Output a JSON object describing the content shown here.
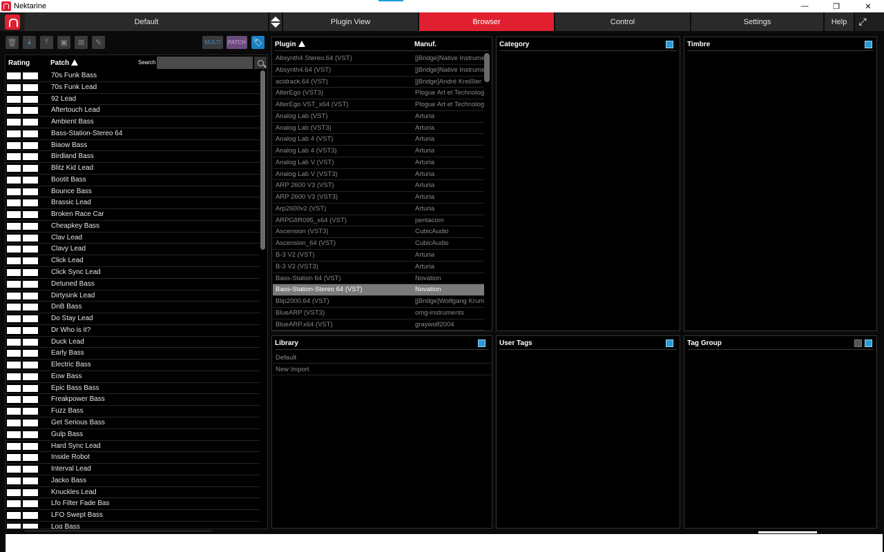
{
  "window": {
    "title": "Nektarine",
    "controls": [
      "—",
      "❐",
      "✕"
    ]
  },
  "nav": {
    "preset": "Default",
    "tabs": [
      {
        "label": "Plugin View",
        "active": false
      },
      {
        "label": "Browser",
        "active": true
      },
      {
        "label": "Control",
        "active": false
      },
      {
        "label": "Settings",
        "active": false
      },
      {
        "label": "Help",
        "active": false
      }
    ]
  },
  "toolbar": {
    "multi_label": "MULTI",
    "patch_label": "PATCH",
    "icons": [
      "trash-icon",
      "download-icon",
      "upload-icon",
      "save-icon",
      "add-icon",
      "edit-icon",
      "tag-icon"
    ]
  },
  "patches": {
    "col_rating": "Rating",
    "col_patch": "Patch",
    "search_label": "Search",
    "search_value": "",
    "items": [
      "70s Funk Bass",
      "70s Funk Lead",
      "92 Lead",
      "Aftertouch Lead",
      "Ambient Bass",
      "Bass-Station-Stereo 64",
      "Biaow Bass",
      "Birdland Bass",
      "Blitz Kid Lead",
      "Bootit Bass",
      "Bounce Bass",
      "Brassic Lead",
      "Broken Race Car",
      "Cheapkey Bass",
      "Clav Lead",
      "Clavy Lead",
      "Click Lead",
      "Click Sync Lead",
      "Detuned Bass",
      "Dirtysink Lead",
      "DnB Bass",
      "Do Stay Lead",
      "Dr Who is it?",
      "Duck Lead",
      "Early Bass",
      "Electric Bass",
      "Eow Bass",
      "Epic Bass Bass",
      "Freakpower Bass",
      "Fuzz Bass",
      "Get Serious Bass",
      "Gulp Bass",
      "Hard Sync Lead",
      "Inside Robot",
      "Interval Lead",
      "Jacko Bass",
      "Knuckles Lead",
      "Lfo Filter Fade Bas",
      "LFO Swept Bass",
      "Log Bass"
    ]
  },
  "plugins": {
    "col_plugin": "Plugin",
    "col_manuf": "Manuf.",
    "items": [
      {
        "name": "Absynth4 Stereo.64 (VST)",
        "manuf": "[jBridge]Native Instrume"
      },
      {
        "name": "Absynth4.64 (VST)",
        "manuf": "[jBridge]Native Instrume"
      },
      {
        "name": "acidrack.64 (VST)",
        "manuf": "[jBridge]André Kreißler"
      },
      {
        "name": "AlterEgo (VST3)",
        "manuf": "Plogue Art et Technologi"
      },
      {
        "name": "AlterEgo VST_x64 (VST)",
        "manuf": "Plogue Art et Technologi"
      },
      {
        "name": "Analog Lab (VST)",
        "manuf": "Arturia"
      },
      {
        "name": "Analog Lab (VST3)",
        "manuf": "Arturia"
      },
      {
        "name": "Analog Lab 4 (VST)",
        "manuf": "Arturia"
      },
      {
        "name": "Analog Lab 4 (VST3)",
        "manuf": "Arturia"
      },
      {
        "name": "Analog Lab V (VST)",
        "manuf": "Arturia"
      },
      {
        "name": "Analog Lab V (VST3)",
        "manuf": "Arturia"
      },
      {
        "name": "ARP 2600 V3 (VST)",
        "manuf": "Arturia"
      },
      {
        "name": "ARP 2600 V3 (VST3)",
        "manuf": "Arturia"
      },
      {
        "name": "Arp2600v2 (VST)",
        "manuf": "Arturia"
      },
      {
        "name": "ARPG8R095_x64 (VST)",
        "manuf": "pentacom"
      },
      {
        "name": "Ascension (VST3)",
        "manuf": "CubicAudio"
      },
      {
        "name": "Ascension_64 (VST)",
        "manuf": "CubicAudio"
      },
      {
        "name": "B-3 V2 (VST)",
        "manuf": "Arturia"
      },
      {
        "name": "B-3 V2 (VST3)",
        "manuf": "Arturia"
      },
      {
        "name": "Bass-Station 64 (VST)",
        "manuf": "Novation"
      },
      {
        "name": "Bass-Station-Stereo 64 (VST)",
        "manuf": "Novation",
        "selected": true
      },
      {
        "name": "Blip2000.64 (VST)",
        "manuf": "[jBridge]Wolfgang Krum"
      },
      {
        "name": "BlueARP (VST3)",
        "manuf": "omg-instruments"
      },
      {
        "name": "BlueARP.x64 (VST)",
        "manuf": "graywolf2004"
      }
    ]
  },
  "panels": {
    "category": "Category",
    "timbre": "Timbre",
    "library": "Library",
    "user_tags": "User Tags",
    "tag_group": "Tag Group"
  },
  "library": {
    "items": [
      "Default",
      "New Import"
    ]
  },
  "colors": {
    "accent_red": "#e02030",
    "accent_blue": "#2a9bd6",
    "patch_pill": "#6a4c7a"
  }
}
